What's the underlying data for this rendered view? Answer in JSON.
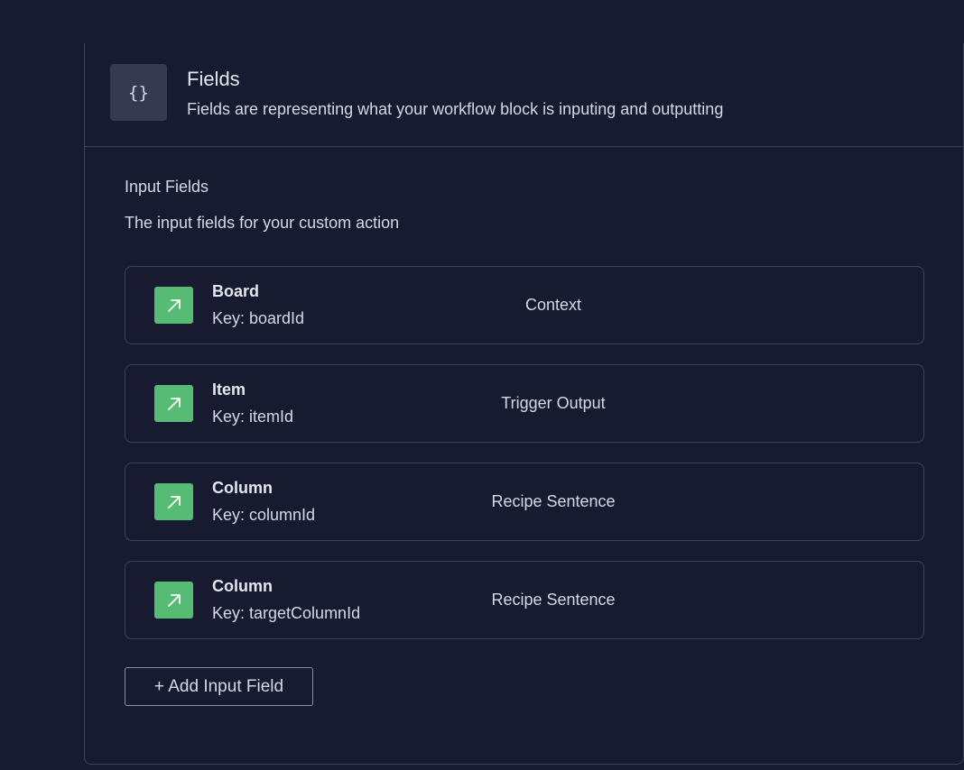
{
  "fields_panel": {
    "icon": "curly-braces-icon",
    "icon_glyph": "{}",
    "title": "Fields",
    "description": "Fields are representing what your workflow block is inputing and outputting"
  },
  "input_fields": {
    "title": "Input Fields",
    "description": "The input fields for your custom action",
    "items": [
      {
        "icon": "arrow-up-right-icon",
        "name": "Board",
        "key": "Key: boardId",
        "source": "Context"
      },
      {
        "icon": "arrow-up-right-icon",
        "name": "Item",
        "key": "Key: itemId",
        "source": "Trigger Output"
      },
      {
        "icon": "arrow-up-right-icon",
        "name": "Column",
        "key": "Key: columnId",
        "source": "Recipe Sentence"
      },
      {
        "icon": "arrow-up-right-icon",
        "name": "Column",
        "key": "Key: targetColumnId",
        "source": "Recipe Sentence"
      }
    ],
    "add_button_label": "+ Add Input Field"
  },
  "colors": {
    "background": "#181b30",
    "border": "#3e4257",
    "icon_tile": "#353a50",
    "accent_green": "#56bb73"
  }
}
